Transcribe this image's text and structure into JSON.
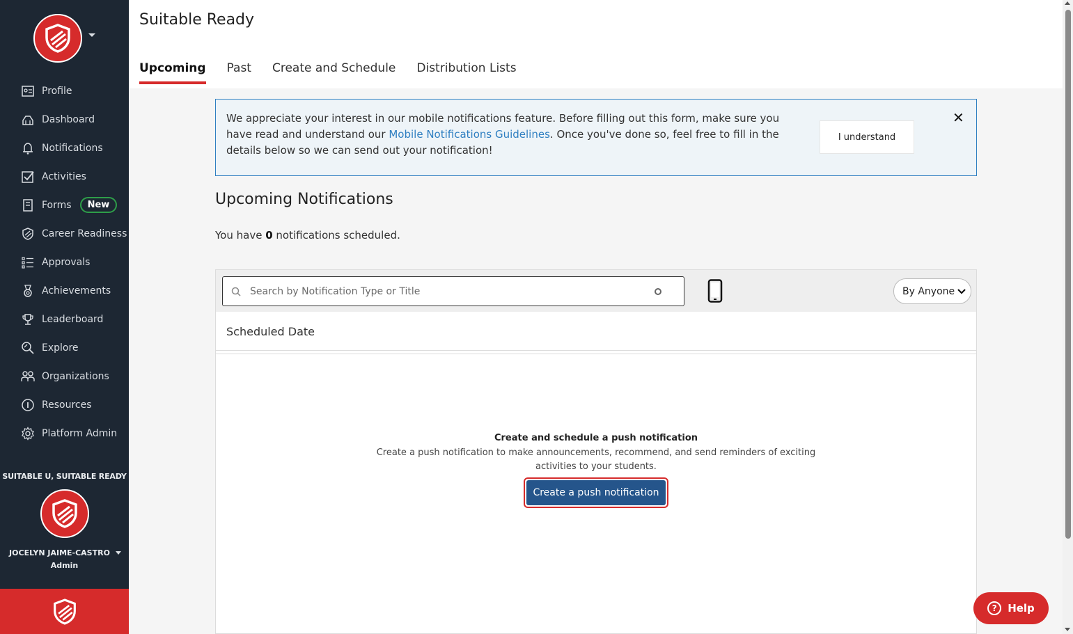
{
  "colors": {
    "sidebar_bg": "#1d2733",
    "brand_red": "#d62b2b",
    "primary_button": "#25558b",
    "link_blue": "#2f7fc1",
    "badge_green": "#2e9e49"
  },
  "sidebar": {
    "items": [
      {
        "label": "Profile",
        "icon": "profile-card-icon"
      },
      {
        "label": "Dashboard",
        "icon": "dashboard-icon"
      },
      {
        "label": "Notifications",
        "icon": "bell-icon"
      },
      {
        "label": "Activities",
        "icon": "checkbox-icon"
      },
      {
        "label": "Forms",
        "icon": "form-icon",
        "badge": "New"
      },
      {
        "label": "Career Readiness",
        "icon": "shield-icon"
      },
      {
        "label": "Approvals",
        "icon": "list-check-icon"
      },
      {
        "label": "Achievements",
        "icon": "medal-icon"
      },
      {
        "label": "Leaderboard",
        "icon": "trophy-icon"
      },
      {
        "label": "Explore",
        "icon": "explore-icon"
      },
      {
        "label": "Organizations",
        "icon": "people-icon"
      },
      {
        "label": "Resources",
        "icon": "info-circle-icon"
      },
      {
        "label": "Platform Admin",
        "icon": "gear-icon"
      }
    ],
    "org_label": "SUITABLE U, SUITABLE READY",
    "user_name": "JOCELYN JAIME-CASTRO",
    "user_role": "Admin"
  },
  "header": {
    "title": "Suitable Ready",
    "tabs": [
      "Upcoming",
      "Past",
      "Create and Schedule",
      "Distribution Lists"
    ],
    "active_tab": "Upcoming"
  },
  "notice": {
    "text_before": "We appreciate your interest in our mobile notifications feature. Before filling out this form, make sure you have read and understand our ",
    "link_text": "Mobile Notifications Guidelines",
    "text_after": ". Once you've done so, feel free to fill in the details below so we can send out your notification!",
    "button_label": "I understand",
    "close_label": "✕"
  },
  "main": {
    "section_title": "Upcoming Notifications",
    "count_prefix": "You have ",
    "count": "0",
    "count_suffix": " notifications scheduled.",
    "search_placeholder": "Search by Notification Type or Title",
    "filter_label": "By Anyone",
    "column_header": "Scheduled Date",
    "empty_title": "Create and schedule a push notification",
    "empty_desc": "Create a push notification to make announcements, recommend, and send reminders of exciting activities to your students.",
    "create_button": "Create a push notification"
  },
  "help": {
    "label": "Help",
    "icon_text": "?"
  }
}
